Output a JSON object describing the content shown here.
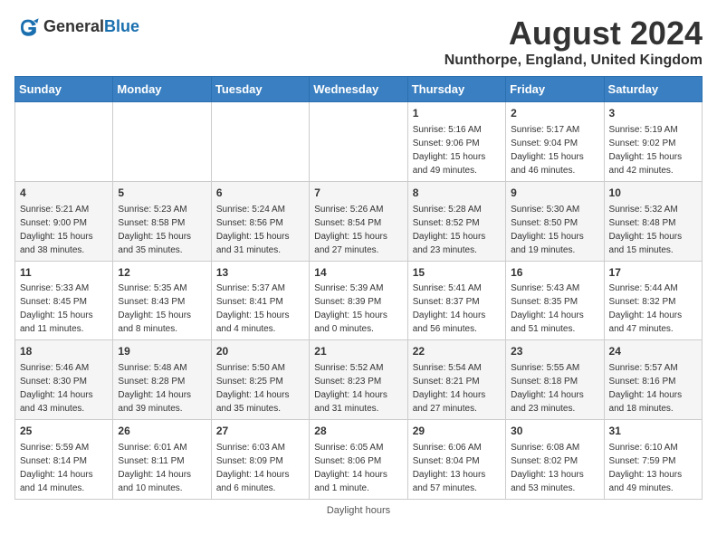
{
  "header": {
    "logo_general": "General",
    "logo_blue": "Blue",
    "month_year": "August 2024",
    "location": "Nunthorpe, England, United Kingdom"
  },
  "days_of_week": [
    "Sunday",
    "Monday",
    "Tuesday",
    "Wednesday",
    "Thursday",
    "Friday",
    "Saturday"
  ],
  "weeks": [
    [
      {
        "day": "",
        "info": ""
      },
      {
        "day": "",
        "info": ""
      },
      {
        "day": "",
        "info": ""
      },
      {
        "day": "",
        "info": ""
      },
      {
        "day": "1",
        "info": "Sunrise: 5:16 AM\nSunset: 9:06 PM\nDaylight: 15 hours and 49 minutes."
      },
      {
        "day": "2",
        "info": "Sunrise: 5:17 AM\nSunset: 9:04 PM\nDaylight: 15 hours and 46 minutes."
      },
      {
        "day": "3",
        "info": "Sunrise: 5:19 AM\nSunset: 9:02 PM\nDaylight: 15 hours and 42 minutes."
      }
    ],
    [
      {
        "day": "4",
        "info": "Sunrise: 5:21 AM\nSunset: 9:00 PM\nDaylight: 15 hours and 38 minutes."
      },
      {
        "day": "5",
        "info": "Sunrise: 5:23 AM\nSunset: 8:58 PM\nDaylight: 15 hours and 35 minutes."
      },
      {
        "day": "6",
        "info": "Sunrise: 5:24 AM\nSunset: 8:56 PM\nDaylight: 15 hours and 31 minutes."
      },
      {
        "day": "7",
        "info": "Sunrise: 5:26 AM\nSunset: 8:54 PM\nDaylight: 15 hours and 27 minutes."
      },
      {
        "day": "8",
        "info": "Sunrise: 5:28 AM\nSunset: 8:52 PM\nDaylight: 15 hours and 23 minutes."
      },
      {
        "day": "9",
        "info": "Sunrise: 5:30 AM\nSunset: 8:50 PM\nDaylight: 15 hours and 19 minutes."
      },
      {
        "day": "10",
        "info": "Sunrise: 5:32 AM\nSunset: 8:48 PM\nDaylight: 15 hours and 15 minutes."
      }
    ],
    [
      {
        "day": "11",
        "info": "Sunrise: 5:33 AM\nSunset: 8:45 PM\nDaylight: 15 hours and 11 minutes."
      },
      {
        "day": "12",
        "info": "Sunrise: 5:35 AM\nSunset: 8:43 PM\nDaylight: 15 hours and 8 minutes."
      },
      {
        "day": "13",
        "info": "Sunrise: 5:37 AM\nSunset: 8:41 PM\nDaylight: 15 hours and 4 minutes."
      },
      {
        "day": "14",
        "info": "Sunrise: 5:39 AM\nSunset: 8:39 PM\nDaylight: 15 hours and 0 minutes."
      },
      {
        "day": "15",
        "info": "Sunrise: 5:41 AM\nSunset: 8:37 PM\nDaylight: 14 hours and 56 minutes."
      },
      {
        "day": "16",
        "info": "Sunrise: 5:43 AM\nSunset: 8:35 PM\nDaylight: 14 hours and 51 minutes."
      },
      {
        "day": "17",
        "info": "Sunrise: 5:44 AM\nSunset: 8:32 PM\nDaylight: 14 hours and 47 minutes."
      }
    ],
    [
      {
        "day": "18",
        "info": "Sunrise: 5:46 AM\nSunset: 8:30 PM\nDaylight: 14 hours and 43 minutes."
      },
      {
        "day": "19",
        "info": "Sunrise: 5:48 AM\nSunset: 8:28 PM\nDaylight: 14 hours and 39 minutes."
      },
      {
        "day": "20",
        "info": "Sunrise: 5:50 AM\nSunset: 8:25 PM\nDaylight: 14 hours and 35 minutes."
      },
      {
        "day": "21",
        "info": "Sunrise: 5:52 AM\nSunset: 8:23 PM\nDaylight: 14 hours and 31 minutes."
      },
      {
        "day": "22",
        "info": "Sunrise: 5:54 AM\nSunset: 8:21 PM\nDaylight: 14 hours and 27 minutes."
      },
      {
        "day": "23",
        "info": "Sunrise: 5:55 AM\nSunset: 8:18 PM\nDaylight: 14 hours and 23 minutes."
      },
      {
        "day": "24",
        "info": "Sunrise: 5:57 AM\nSunset: 8:16 PM\nDaylight: 14 hours and 18 minutes."
      }
    ],
    [
      {
        "day": "25",
        "info": "Sunrise: 5:59 AM\nSunset: 8:14 PM\nDaylight: 14 hours and 14 minutes."
      },
      {
        "day": "26",
        "info": "Sunrise: 6:01 AM\nSunset: 8:11 PM\nDaylight: 14 hours and 10 minutes."
      },
      {
        "day": "27",
        "info": "Sunrise: 6:03 AM\nSunset: 8:09 PM\nDaylight: 14 hours and 6 minutes."
      },
      {
        "day": "28",
        "info": "Sunrise: 6:05 AM\nSunset: 8:06 PM\nDaylight: 14 hours and 1 minute."
      },
      {
        "day": "29",
        "info": "Sunrise: 6:06 AM\nSunset: 8:04 PM\nDaylight: 13 hours and 57 minutes."
      },
      {
        "day": "30",
        "info": "Sunrise: 6:08 AM\nSunset: 8:02 PM\nDaylight: 13 hours and 53 minutes."
      },
      {
        "day": "31",
        "info": "Sunrise: 6:10 AM\nSunset: 7:59 PM\nDaylight: 13 hours and 49 minutes."
      }
    ]
  ],
  "footer": {
    "daylight_label": "Daylight hours"
  },
  "colors": {
    "header_bg": "#3a7fc1",
    "header_text": "#ffffff",
    "accent": "#1a6faf"
  }
}
